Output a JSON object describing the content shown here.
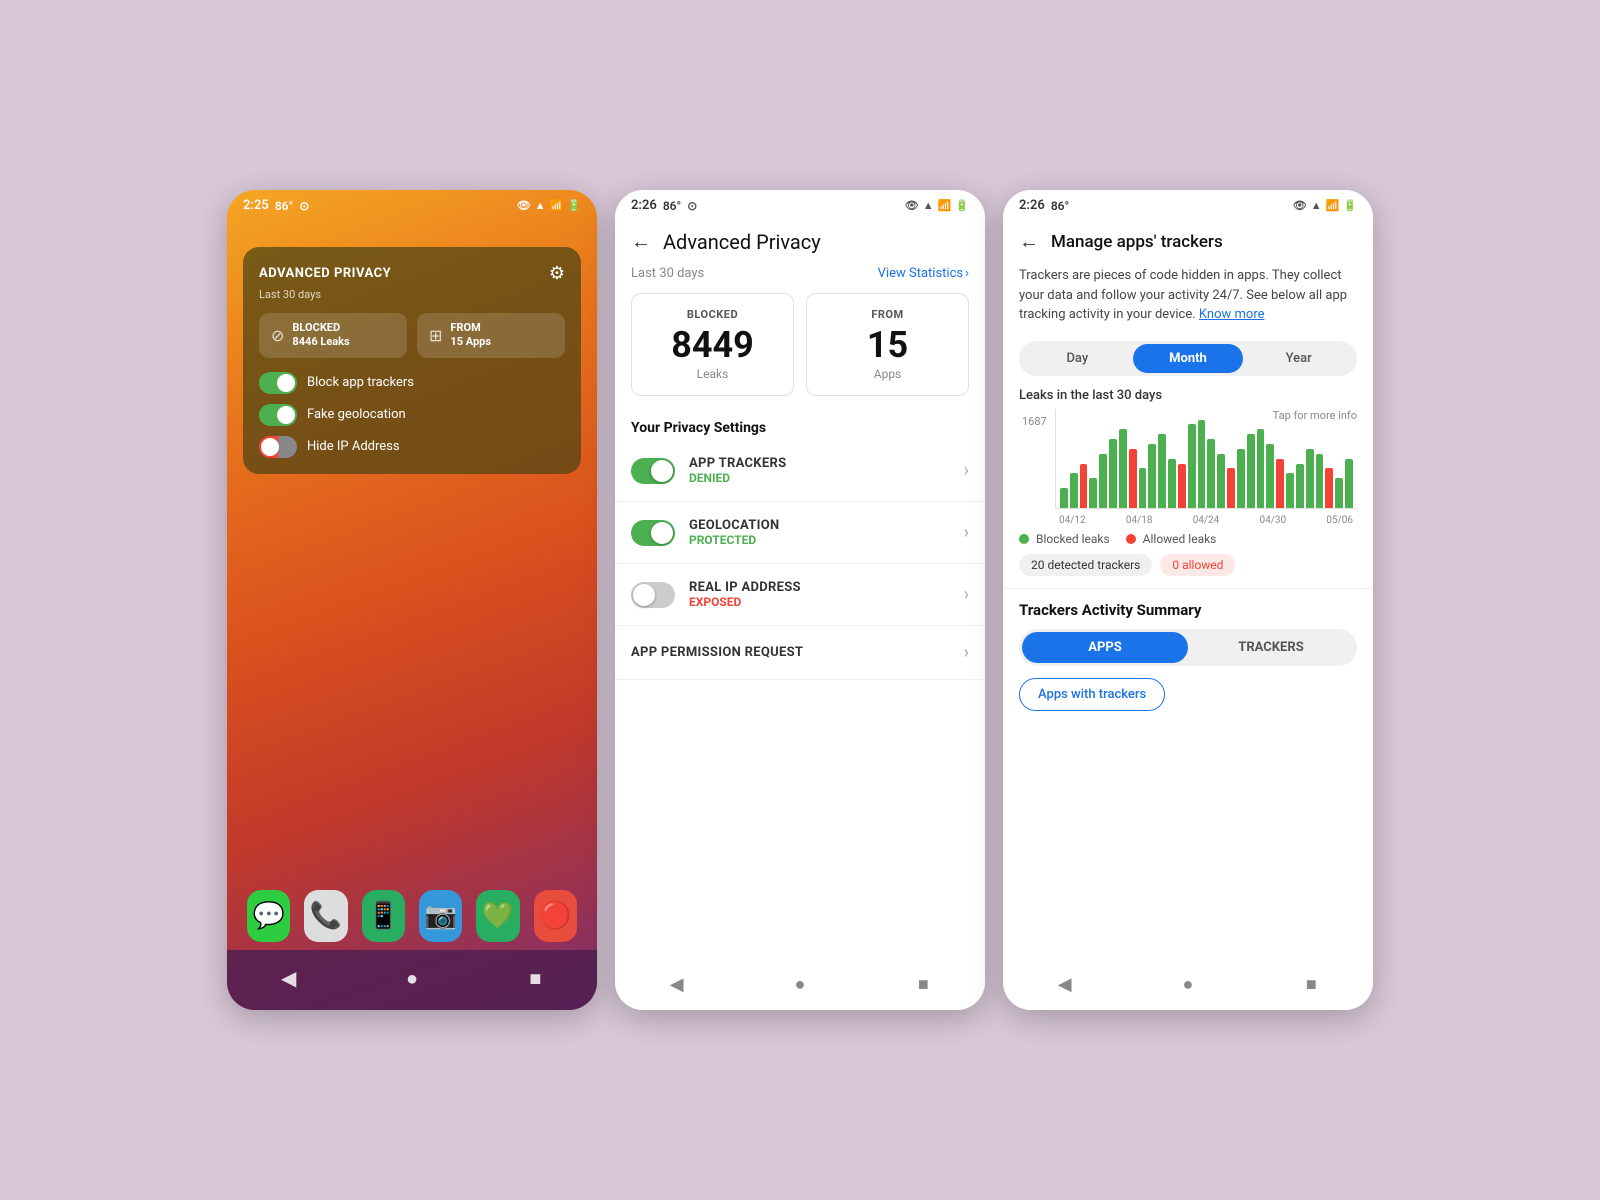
{
  "screen1": {
    "status_time": "2:25",
    "status_temp": "86°",
    "widget": {
      "title": "ADVANCED PRIVACY",
      "subtitle": "Last 30 days",
      "blocked_label": "BLOCKED",
      "blocked_value": "8446 Leaks",
      "from_label": "FROM",
      "from_value": "15 Apps",
      "toggle1_label": "Block app trackers",
      "toggle2_label": "Fake geolocation",
      "toggle3_label": "Hide IP Address"
    },
    "dock_apps": [
      "💬",
      "📞",
      "📱",
      "📷",
      "💚",
      "🔴"
    ]
  },
  "screen2": {
    "status_time": "2:26",
    "status_temp": "86°",
    "title": "Advanced Privacy",
    "period": "Last 30 days",
    "view_stats": "View Statistics",
    "blocked_label": "BLOCKED",
    "blocked_value": "8449",
    "blocked_sub": "Leaks",
    "from_label": "FROM",
    "from_value": "15",
    "from_sub": "Apps",
    "privacy_settings_label": "Your Privacy Settings",
    "trackers_name": "APP TRACKERS",
    "trackers_status": "DENIED",
    "geolocation_name": "GEOLOCATION",
    "geolocation_status": "PROTECTED",
    "ip_name": "REAL IP ADDRESS",
    "ip_status": "EXPOSED",
    "permission_name": "APP PERMISSION REQUEST"
  },
  "screen3": {
    "status_time": "2:26",
    "status_temp": "86°",
    "title": "Manage apps' trackers",
    "description": "Trackers are pieces of code hidden in apps. They collect your data and follow your activity 24/7. See below all app tracking activity in your device.",
    "know_more": "Know more",
    "tab_day": "Day",
    "tab_month": "Month",
    "tab_year": "Year",
    "chart_label": "Leaks in the last 30 days",
    "chart_tap_info": "Tap for more info",
    "chart_y_value": "1687",
    "chart_x_labels": [
      "04/12",
      "04/18",
      "04/24",
      "04/30",
      "05/06"
    ],
    "legend_blocked": "Blocked leaks",
    "legend_allowed": "Allowed leaks",
    "badge_detected": "20 detected trackers",
    "badge_allowed": "0 allowed",
    "activity_label": "Trackers Activity Summary",
    "tab_apps": "APPS",
    "tab_trackers": "TRACKERS",
    "apps_with_trackers": "Apps with trackers",
    "chart_bars": [
      20,
      35,
      45,
      30,
      55,
      70,
      80,
      60,
      40,
      65,
      75,
      50,
      45,
      85,
      90,
      70,
      55,
      40,
      60,
      75,
      80,
      65,
      50,
      35,
      45,
      60,
      55,
      40,
      30,
      50
    ]
  },
  "nav": {
    "back": "◀",
    "home": "●",
    "recents": "■"
  }
}
